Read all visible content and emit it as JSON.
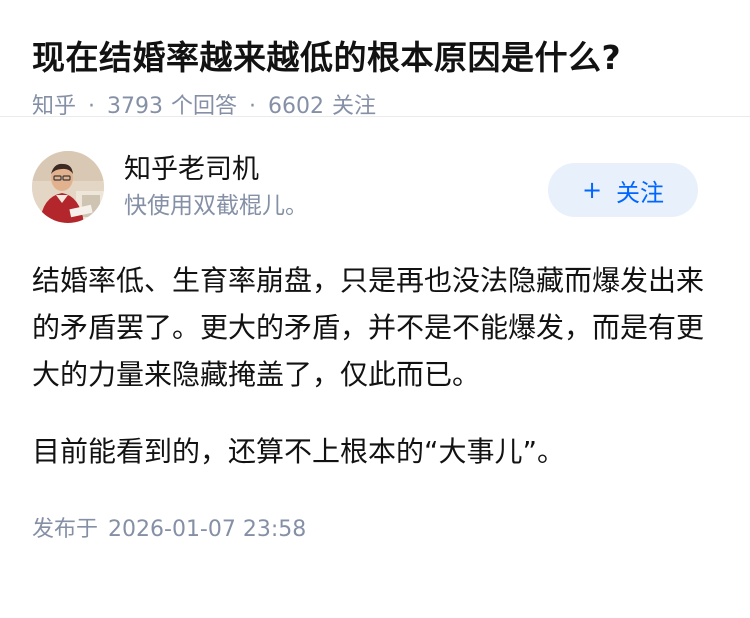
{
  "question": {
    "title": "现在结婚率越来越低的根本原因是什么?",
    "source": "知乎",
    "separator": "·",
    "answer_count": "3793",
    "answer_label": "个回答",
    "follower_count": "6602",
    "follower_label": "关注"
  },
  "answer": {
    "author": {
      "name": "知乎老司机",
      "bio": "快使用双截棍儿。",
      "avatar_icon": "avatar-photo-icon"
    },
    "follow_button": {
      "icon": "+",
      "label": "关注"
    },
    "paragraphs": [
      "结婚率低、生育率崩盘，只是再也没法隐藏而爆发出来的矛盾罢了。更大的矛盾，并不是不能爆发，而是有更大的力量来隐藏掩盖了，仅此而已。",
      "目前能看到的，还算不上根本的“大事儿”。"
    ],
    "publish_label": "发布于",
    "publish_time": "2026-01-07 23:58"
  },
  "colors": {
    "title": "#121212",
    "meta": "#8590a6",
    "accent": "#0066ff",
    "follow_bg": "#e8f0fb",
    "divider": "#ebebeb"
  }
}
